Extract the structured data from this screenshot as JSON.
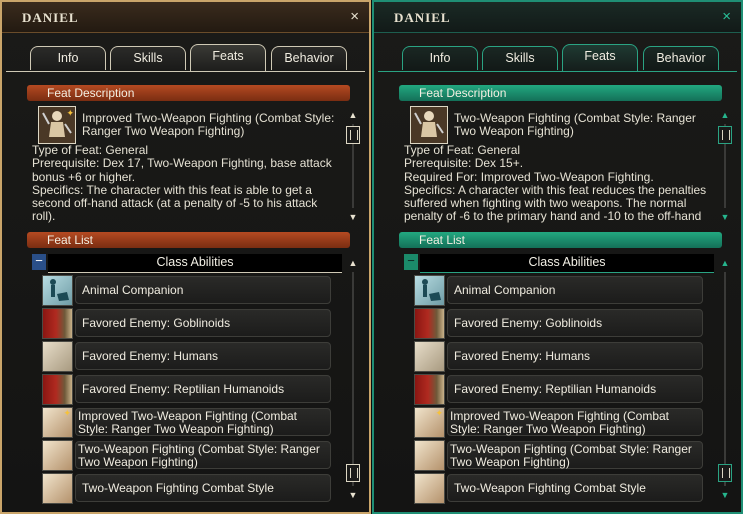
{
  "colors": {
    "left_accent": "#caa56a",
    "right_accent": "#1f8f75",
    "left_section": "#b54a22",
    "right_section": "#22a880"
  },
  "panels": [
    {
      "title": "Daniel",
      "close": "×",
      "tabs": [
        "Info",
        "Skills",
        "Feats",
        "Behavior"
      ],
      "active_tab": "Feats",
      "section_desc": "Feat Description",
      "section_list": "Feat List",
      "desc": {
        "icon": "two-weapon-fighter-icon",
        "name": "Improved Two-Weapon Fighting (Combat Style: Ranger Two Weapon Fighting)",
        "lines": [
          "Type of Feat: General",
          "Prerequisite: Dex 17, Two-Weapon Fighting, base attack bonus +6 or higher.",
          "Specifics: The character with this feat is able to get a second off-hand attack (at a penalty of -5 to his attack roll)."
        ]
      },
      "group": {
        "toggle": "−",
        "label": "Class Abilities"
      },
      "items": [
        {
          "label": "Animal Companion",
          "icon": "animal-companion-icon"
        },
        {
          "label": "Favored Enemy: Goblinoids",
          "icon": "favored-enemy-icon"
        },
        {
          "label": "Favored Enemy: Humans",
          "icon": "favored-enemy-icon"
        },
        {
          "label": "Favored Enemy: Reptilian Humanoids",
          "icon": "favored-enemy-icon"
        },
        {
          "label": "Improved Two-Weapon Fighting (Combat Style: Ranger Two Weapon Fighting)",
          "icon": "improved-two-weapon-icon"
        },
        {
          "label": "Two-Weapon Fighting (Combat Style: Ranger Two Weapon Fighting)",
          "icon": "two-weapon-icon"
        },
        {
          "label": "Two-Weapon Fighting Combat Style",
          "icon": "two-weapon-icon"
        }
      ]
    },
    {
      "title": "Daniel",
      "close": "×",
      "tabs": [
        "Info",
        "Skills",
        "Feats",
        "Behavior"
      ],
      "active_tab": "Feats",
      "section_desc": "Feat Description",
      "section_list": "Feat List",
      "desc": {
        "icon": "two-weapon-fighter-icon",
        "name": "Two-Weapon Fighting (Combat Style: Ranger Two Weapon Fighting)",
        "lines": [
          "Type of Feat: General",
          "Prerequisite: Dex 15+.",
          "Required For: Improved Two-Weapon Fighting.",
          "Specifics: A character with this feat reduces the penalties suffered when fighting with two weapons. The normal penalty of -6 to the primary hand and -10 to the off-hand"
        ]
      },
      "group": {
        "toggle": "−",
        "label": "Class Abilities"
      },
      "items": [
        {
          "label": "Animal Companion",
          "icon": "animal-companion-icon"
        },
        {
          "label": "Favored Enemy: Goblinoids",
          "icon": "favored-enemy-icon"
        },
        {
          "label": "Favored Enemy: Humans",
          "icon": "favored-enemy-icon"
        },
        {
          "label": "Favored Enemy: Reptilian Humanoids",
          "icon": "favored-enemy-icon"
        },
        {
          "label": "Improved Two-Weapon Fighting (Combat Style: Ranger Two Weapon Fighting)",
          "icon": "improved-two-weapon-icon"
        },
        {
          "label": "Two-Weapon Fighting (Combat Style: Ranger Two Weapon Fighting)",
          "icon": "two-weapon-icon"
        },
        {
          "label": "Two-Weapon Fighting Combat Style",
          "icon": "two-weapon-icon"
        }
      ]
    }
  ]
}
